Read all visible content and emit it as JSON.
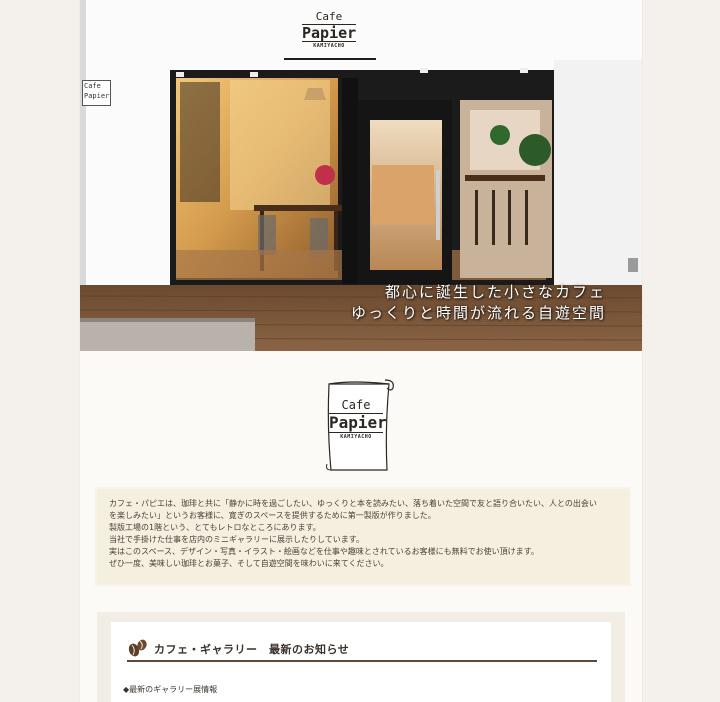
{
  "hero": {
    "sign_line1": "Cafe",
    "sign_line2": "Papier",
    "sign_line3": "KAMIYACHO",
    "hanging_sign": "Cafe Papier",
    "catch_line1": "都心に誕生した小さなカフェ",
    "catch_line2": "ゆっくりと時間が流れる自遊空間"
  },
  "logo": {
    "line1": "Cafe",
    "line2": "Papier",
    "line3": "KAMIYACHO"
  },
  "intro": {
    "paragraphs": [
      "カフェ・パピエは、珈琲と共に「静かに時を過ごしたい、ゆっくりと本を読みたい、落ち着いた空間で友と語り合いたい、人との出会い",
      "を楽しみたい」というお客様に、寛ぎのスペースを提供するために第一製版が作りました。",
      "製版工場の1階という、とてもレトロなところにあります。",
      "当社で手掛けた仕事を店内のミニギャラリーに展示したりしています。",
      "実はこのスペース、デザイン・写真・イラスト・絵画などを仕事や趣味とされているお客様にも無料でお使い頂けます。",
      "ぜひ一度、美味しい珈琲とお菓子、そして自遊空間を味わいに来てください。"
    ]
  },
  "news": {
    "title": "カフェ・ギャラリー　最新のお知らせ",
    "item": "◆最新のギャラリー展情報"
  },
  "colors": {
    "background": "#f4f1ec",
    "page": "#fbfaf7",
    "intro_box": "#f5efdf",
    "news_rule": "#5a4a3c"
  }
}
